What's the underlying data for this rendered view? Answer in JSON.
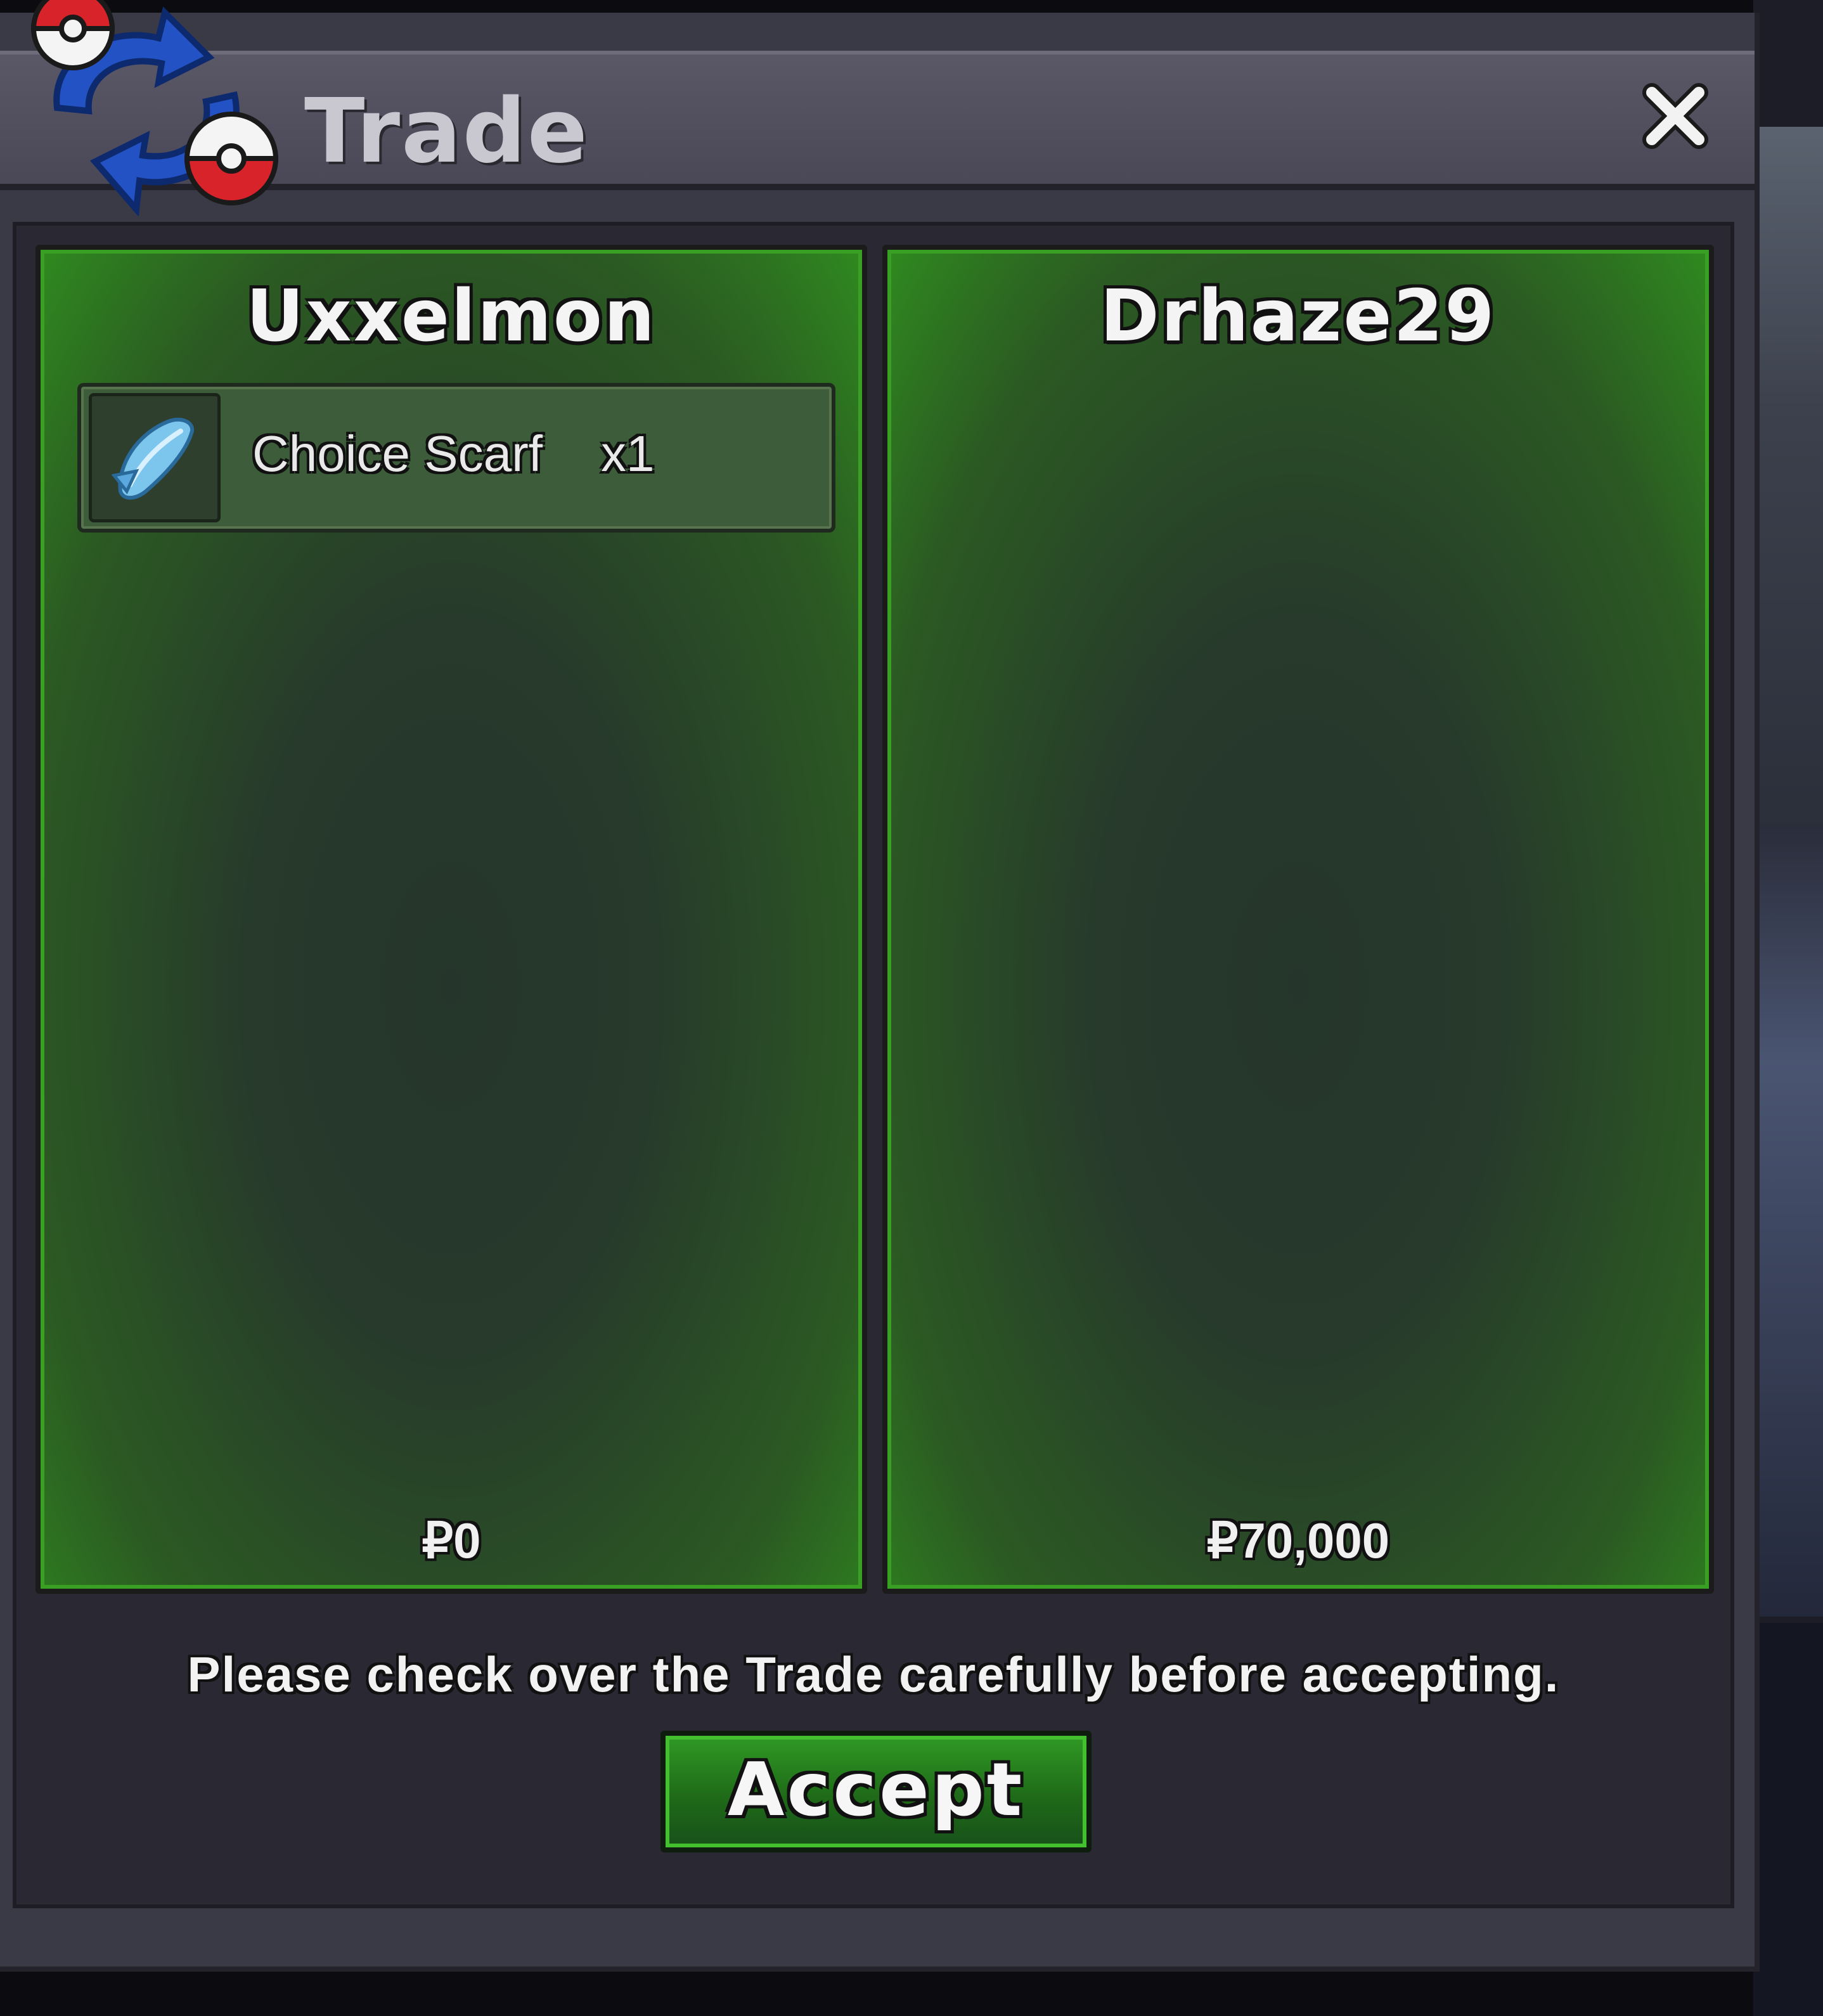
{
  "window": {
    "title": "Trade",
    "close_icon": "close-icon",
    "logo_icon": "pokeball-trade-icon"
  },
  "trade": {
    "left": {
      "player_name": "Uxxelmon",
      "items": [
        {
          "name": "Choice Scarf",
          "quantity": "x1",
          "icon": "scarf-icon"
        }
      ],
      "money": "₽0"
    },
    "right": {
      "player_name": "Drhaze29",
      "items": [],
      "money": "₽70,000"
    }
  },
  "notice": "Please check over the Trade carefully before accepting.",
  "accept_label": "Accept",
  "colors": {
    "panel_green": "#2f8a1f",
    "window_bg": "#3a3946",
    "pokeball_red": "#d9232a",
    "arrow_blue": "#1f4fb8"
  }
}
